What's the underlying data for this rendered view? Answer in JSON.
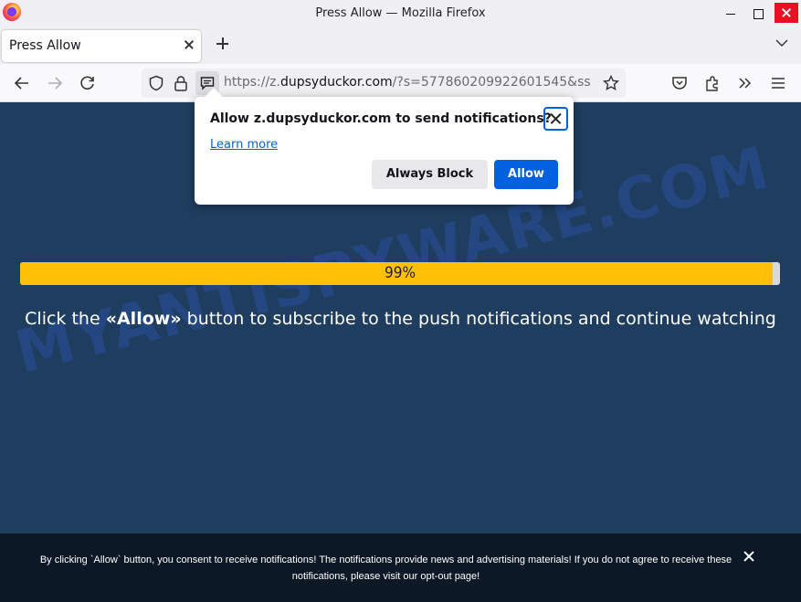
{
  "window": {
    "title": "Press Allow — Mozilla Firefox"
  },
  "tab": {
    "label": "Press Allow"
  },
  "urlbar": {
    "scheme": "https://z.",
    "host": "dupsyduckor.com",
    "rest": "/?s=577860209922601545&ss"
  },
  "popup": {
    "title": "Allow z.dupsyduckor.com to send notifications?",
    "learn_more": "Learn more",
    "block_label": "Always Block",
    "allow_label": "Allow"
  },
  "page": {
    "watermark": "MYANTISPYWARE.COM",
    "progress": {
      "percent": 99,
      "label": "99%",
      "fill_color": "#ffc107"
    },
    "headline_before": "Click the ",
    "headline_bold": "«Allow»",
    "headline_after": " button to subscribe to the push notifications and continue watching"
  },
  "consent": {
    "text_main": "By clicking `Allow` button, you consent to receive notifications! The notifications provide news and advertising materials! If you do not agree to receive these notifications, please visit our ",
    "link_text": "opt-out page",
    "text_end": "!"
  },
  "icons": [
    "firefox-logo",
    "back-arrow-icon",
    "forward-arrow-icon",
    "reload-icon",
    "shield-icon",
    "lock-icon",
    "notification-permission-icon",
    "bookmark-star-icon",
    "pocket-icon",
    "extensions-icon",
    "overflow-chevrons-icon",
    "hamburger-menu-icon",
    "tab-list-chevron-icon"
  ]
}
